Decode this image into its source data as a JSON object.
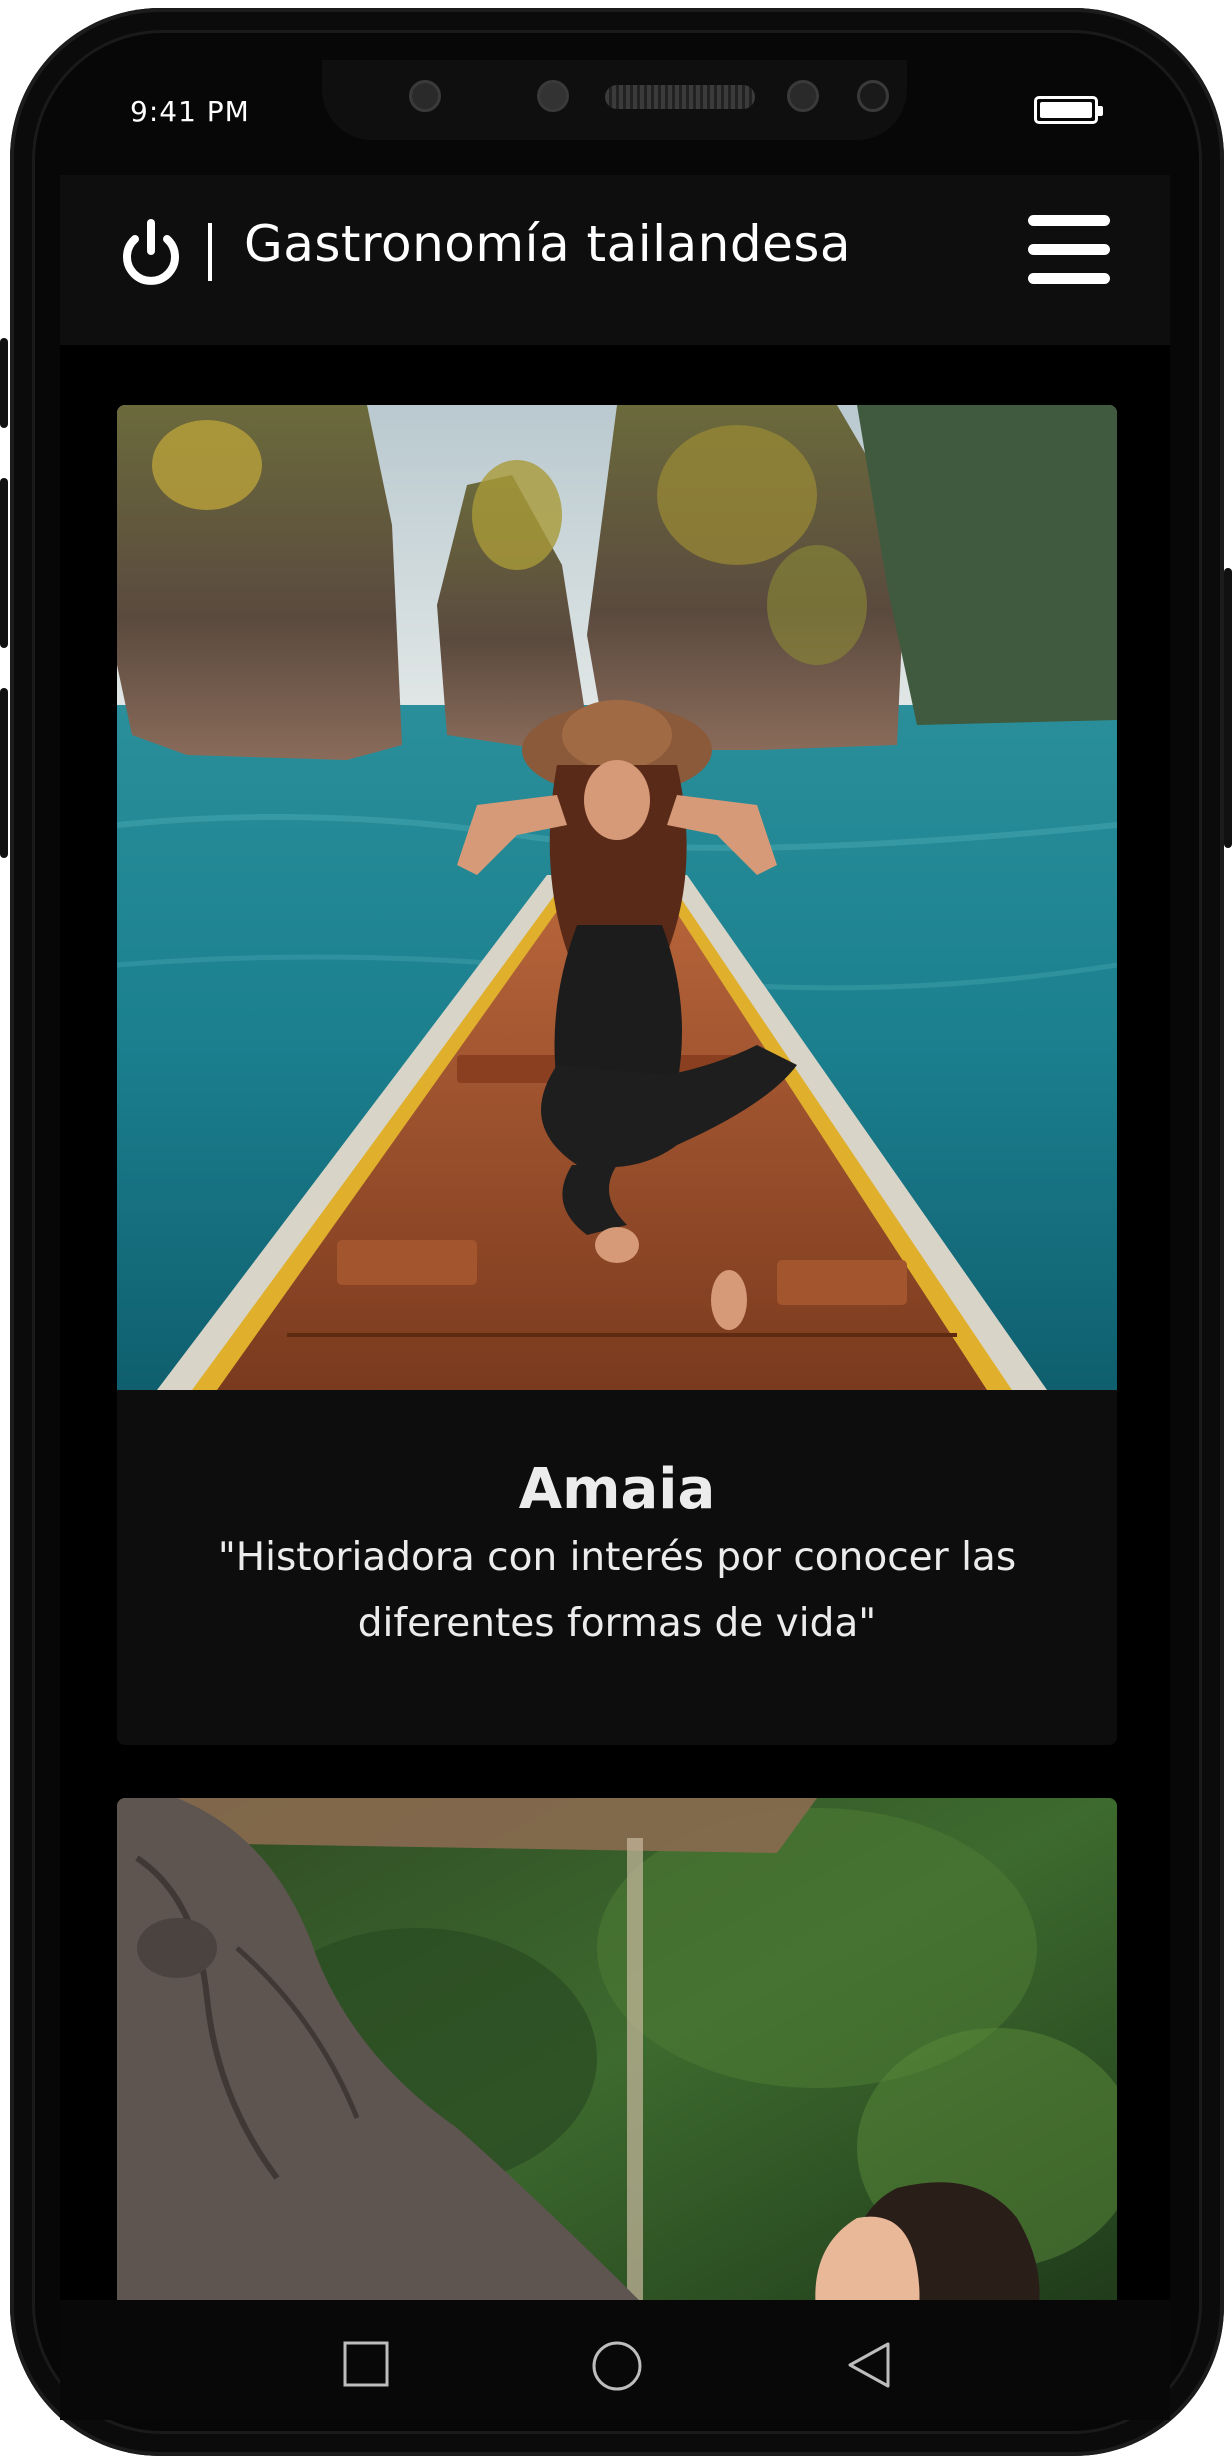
{
  "status_bar": {
    "time": "9:41 PM",
    "battery_level": 1.0
  },
  "app_bar": {
    "title": "Gastronomía tailandesa",
    "logo_icon": "power-icon",
    "menu_icon": "hamburger-menu-icon"
  },
  "profiles": [
    {
      "photo": "woman-in-longtail-boat-photo",
      "name": "Amaia",
      "quote": "\"Historiadora con interés por conocer las diferentes formas de vida\""
    },
    {
      "photo": "elephant-and-woman-photo"
    }
  ],
  "nav_bar": {
    "icons": [
      "square-recents-icon",
      "circle-home-icon",
      "triangle-back-icon"
    ]
  },
  "colors": {
    "background": "#000000",
    "card": "#0d0d0d",
    "text": "#ececec",
    "water": "#1b7f8e"
  }
}
